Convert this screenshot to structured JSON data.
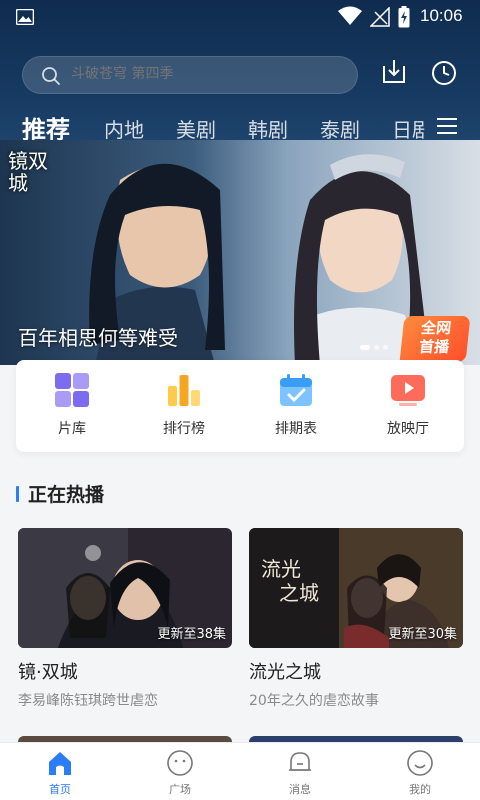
{
  "status_bar": {
    "time": "10:06"
  },
  "search": {
    "placeholder": "斗破苍穹 第四季"
  },
  "tabs": [
    "推荐",
    "内地",
    "美剧",
    "韩剧",
    "泰剧",
    "日剧"
  ],
  "banner": {
    "caption": "百年相思何等难受",
    "logo_text": "镜双城",
    "badge_line1": "全网",
    "badge_line2": "首播",
    "dot_count": 3,
    "active_dot": 0
  },
  "shortcuts": [
    {
      "label": "片库",
      "icon": "grid-icon"
    },
    {
      "label": "排行榜",
      "icon": "ranking-icon"
    },
    {
      "label": "排期表",
      "icon": "calendar-icon"
    },
    {
      "label": "放映厅",
      "icon": "play-screen-icon"
    }
  ],
  "section": {
    "title": "正在热播"
  },
  "shows": [
    {
      "title": "镜·双城",
      "desc": "李易峰陈钰琪跨世虐恋",
      "badge": "更新至38集"
    },
    {
      "title": "流光之城",
      "desc": "20年之久的虐恋故事",
      "badge": "更新至30集"
    }
  ],
  "nav": [
    {
      "label": "首页",
      "icon": "home-icon",
      "active": true
    },
    {
      "label": "广场",
      "icon": "square-icon",
      "active": false
    },
    {
      "label": "消息",
      "icon": "message-icon",
      "active": false
    },
    {
      "label": "我的",
      "icon": "profile-icon",
      "active": false
    }
  ],
  "colors": {
    "accent": "#2a7df4",
    "header_dark": "#0f2c4f",
    "badge_orange": "#ff6a33"
  }
}
